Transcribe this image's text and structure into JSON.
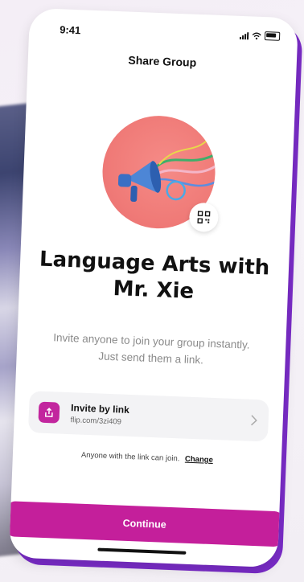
{
  "status_bar": {
    "time": "9:41"
  },
  "header": {
    "title": "Share Group"
  },
  "group": {
    "name": "Language Arts with Mr. Xie"
  },
  "description": "Invite anyone to join your group instantly. Just send them a link.",
  "invite": {
    "title": "Invite by link",
    "link": "flip.com/3zi409"
  },
  "access": {
    "text": "Anyone with the link can join.",
    "change_label": "Change"
  },
  "continue_label": "Continue",
  "colors": {
    "accent": "#c41f9b",
    "hero_bg": "#f07b78",
    "phone_edge": "#7a2cc8"
  },
  "icons": [
    "signal-icon",
    "wifi-icon",
    "battery-icon",
    "megaphone-icon",
    "qr-code-icon",
    "share-icon",
    "chevron-right-icon"
  ]
}
